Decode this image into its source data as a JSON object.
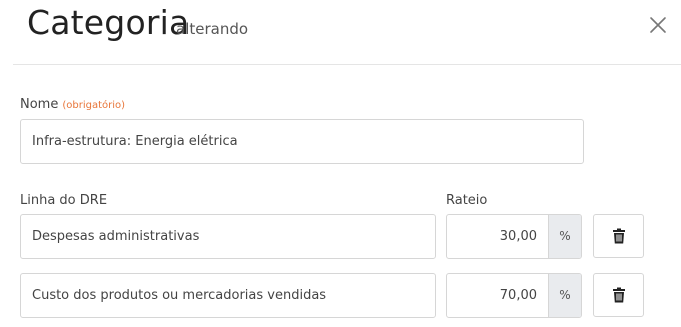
{
  "header": {
    "title": "Categoria",
    "subtitle": "alterando"
  },
  "nome": {
    "label": "Nome",
    "required": "(obrigatório)",
    "value": "Infra-estrutura: Energia elétrica"
  },
  "columns": {
    "dre_label": "Linha do DRE",
    "rateio_label": "Rateio"
  },
  "rows": [
    {
      "dre": "Despesas administrativas",
      "rateio": "30,00",
      "unit": "%"
    },
    {
      "dre": "Custo dos produtos ou mercadorias vendidas",
      "rateio": "70,00",
      "unit": "%"
    }
  ],
  "icons": {
    "close": "close-icon",
    "delete": "trash-icon"
  }
}
